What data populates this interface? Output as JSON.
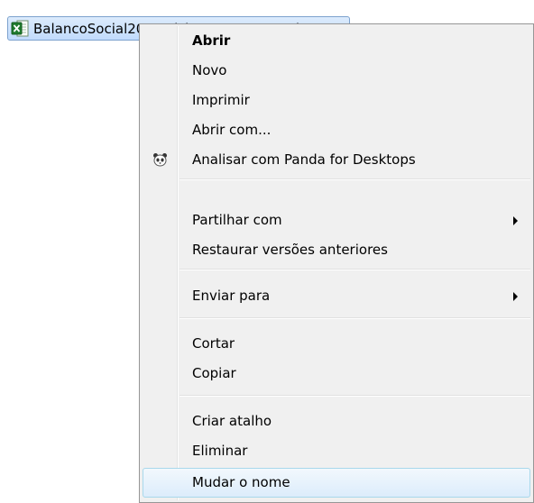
{
  "file": {
    "name": "BalancoSocial2016_riskmanagement.xls",
    "icon": "excel-icon"
  },
  "context_menu": {
    "items": [
      {
        "label": "Abrir",
        "bold": true
      },
      {
        "label": "Novo"
      },
      {
        "label": "Imprimir"
      },
      {
        "label": "Abrir com..."
      },
      {
        "label": "Analisar com Panda for Desktops",
        "icon": "panda-icon"
      },
      {
        "label": "Partilhar com",
        "submenu": true
      },
      {
        "label": "Restaurar versões anteriores"
      },
      {
        "label": "Enviar para",
        "submenu": true
      },
      {
        "label": "Cortar"
      },
      {
        "label": "Copiar"
      },
      {
        "label": "Criar atalho"
      },
      {
        "label": "Eliminar"
      },
      {
        "label": "Mudar o nome",
        "highlighted": true
      }
    ]
  },
  "colors": {
    "menu_background": "#f0f0f0",
    "menu_border": "#979797",
    "hover_border": "#a8d8eb",
    "selection_border": "#7da2ce",
    "selection_fill": "#cce0fa"
  }
}
